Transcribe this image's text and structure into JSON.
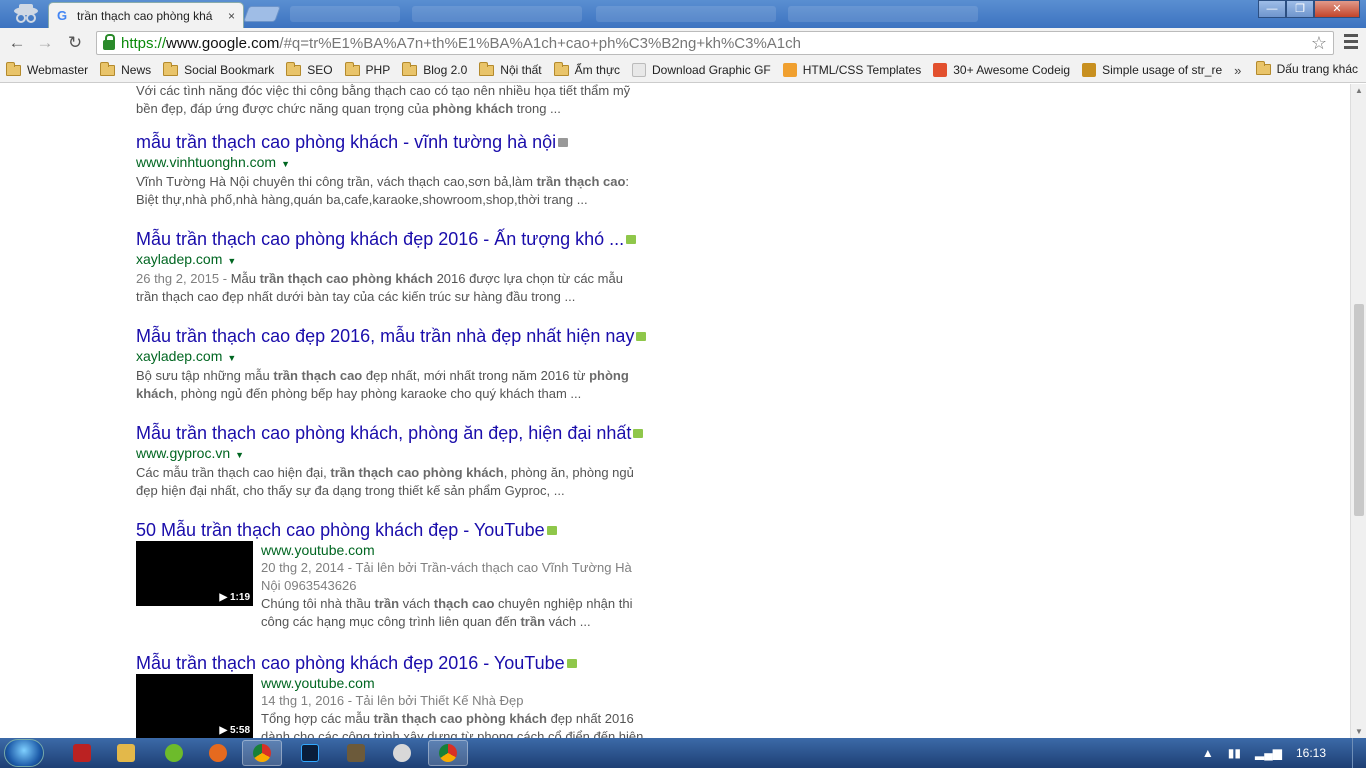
{
  "browser": {
    "tab_title": "trần thạch cao phòng khá",
    "tab_close": "×",
    "url_scheme": "https://",
    "url_host": "www.google.com",
    "url_rest": "/#q=tr%E1%BA%A7n+th%E1%BA%A1ch+cao+ph%C3%B2ng+kh%C3%A1ch",
    "bookmarks": [
      {
        "label": "Webmaster",
        "icon": "folder-icon"
      },
      {
        "label": "News",
        "icon": "folder-icon"
      },
      {
        "label": "Social Bookmark",
        "icon": "folder-icon"
      },
      {
        "label": "SEO",
        "icon": "folder-icon"
      },
      {
        "label": "PHP",
        "icon": "folder-icon"
      },
      {
        "label": "Blog 2.0",
        "icon": "folder-icon"
      },
      {
        "label": "Nội thất",
        "icon": "folder-icon"
      },
      {
        "label": "Ẩm thực",
        "icon": "folder-icon"
      },
      {
        "label": "Download Graphic GF",
        "icon": "page-icon"
      },
      {
        "label": "HTML/CSS Templates",
        "icon": "star-badge-icon"
      },
      {
        "label": "30+ Awesome Codeig",
        "icon": "plus-badge-icon"
      },
      {
        "label": "Simple usage of str_re",
        "icon": "php-icon"
      }
    ],
    "bookmarks_more": "»",
    "other_bookmarks": "Dấu trang khác"
  },
  "results": {
    "top_snippet_line1": "Với các tình năng đóc việc thi công bằng thạch cao có tạo nên nhiều họa tiết thẩm mỹ",
    "top_snippet_line2_pre": "bền đẹp, đáp ứng được chức năng quan trọng của ",
    "top_snippet_line2_bold": "phòng khách",
    "top_snippet_line2_post": " trong ...",
    "items": [
      {
        "title": "mẫu trần thạch cao phòng khách - vĩnh tường hà nội",
        "url": "www.vinhtuonghn.com",
        "line1_a": "Vĩnh Tường Hà Nội chuyên thi công trần, vách thạch cao,sơn bả,làm ",
        "line1_b": "trần thạch cao",
        "line1_c": ":",
        "line2": "Biệt thự,nhà phố,nhà hàng,quán ba,cafe,karaoke,showroom,shop,thời trang ..."
      },
      {
        "title": "Mẫu trần thạch cao phòng khách đẹp 2016 - Ấn tượng khó ...",
        "url": "xayladep.com",
        "date": "26 thg 2, 2015 - ",
        "line1_a": "Mẫu ",
        "line1_b": "trần thạch cao phòng khách",
        "line1_c": " 2016 được lựa chọn từ các mẫu",
        "line2": "trần thạch cao đẹp nhất dưới bàn tay của các kiến trúc sư hàng đầu trong ..."
      },
      {
        "title": "Mẫu trần thạch cao đẹp 2016, mẫu trần nhà đẹp nhất hiện nay",
        "url": "xayladep.com",
        "line1_a": "Bộ sưu tập những mẫu ",
        "line1_b": "trần thạch cao",
        "line1_c": " đẹp nhất, mới nhất trong năm 2016 từ ",
        "line1_d": "phòng",
        "line2_b": "khách",
        "line2": ", phòng ngủ đến phòng bếp hay phòng karaoke cho quý khách tham ..."
      },
      {
        "title": "Mẫu trần thạch cao phòng khách, phòng ăn đẹp, hiện đại nhất",
        "url": "www.gyproc.vn",
        "line1_a": "Các mẫu trần thạch cao hiện đại, ",
        "line1_b": "trần thạch cao phòng khách",
        "line1_c": ", phòng ăn, phòng ngủ",
        "line2": "đẹp hiện đại nhất, cho thấy sự đa dạng trong thiết kế sản phẩm Gyproc, ..."
      },
      {
        "title": "50 Mẫu trần thạch cao phòng khách đẹp - YouTube",
        "url": "www.youtube.com",
        "duration": "▶ 1:19",
        "meta1": "20 thg 2, 2014 - Tải lên bởi Trần-vách thạch cao Vĩnh Tường Hà",
        "meta2": "Nội 0963543626",
        "line1_a": "Chúng tôi nhà thầu ",
        "line1_b": "trần",
        "line1_c": " vách ",
        "line1_d": "thạch cao",
        "line1_e": " chuyên nghiệp nhận thi",
        "line2_a": "công các hạng mục công trình liên quan đến ",
        "line2_b": "trần",
        "line2_c": " vách ..."
      },
      {
        "title": "Mẫu trần thạch cao phòng khách đẹp 2016 - YouTube",
        "url": "www.youtube.com",
        "duration": "▶ 5:58",
        "meta1": "14 thg 1, 2016 - Tải lên bởi Thiết Kế Nhà Đẹp",
        "line1_a": "Tổng hợp các mẫu ",
        "line1_b": "trần thạch cao phòng khách",
        "line1_c": " đẹp nhất 2016",
        "line2": "dành cho các công trình xây dựng từ phong cách cổ điển đến hiện"
      }
    ]
  },
  "taskbar": {
    "clock": "16:13",
    "apps": [
      "filezilla-icon",
      "explorer-icon",
      "greenshot-icon",
      "firefox-icon",
      "chrome-icon",
      "photoshop-icon",
      "notepad-icon",
      "paint-icon",
      "chrome-window-icon"
    ]
  }
}
